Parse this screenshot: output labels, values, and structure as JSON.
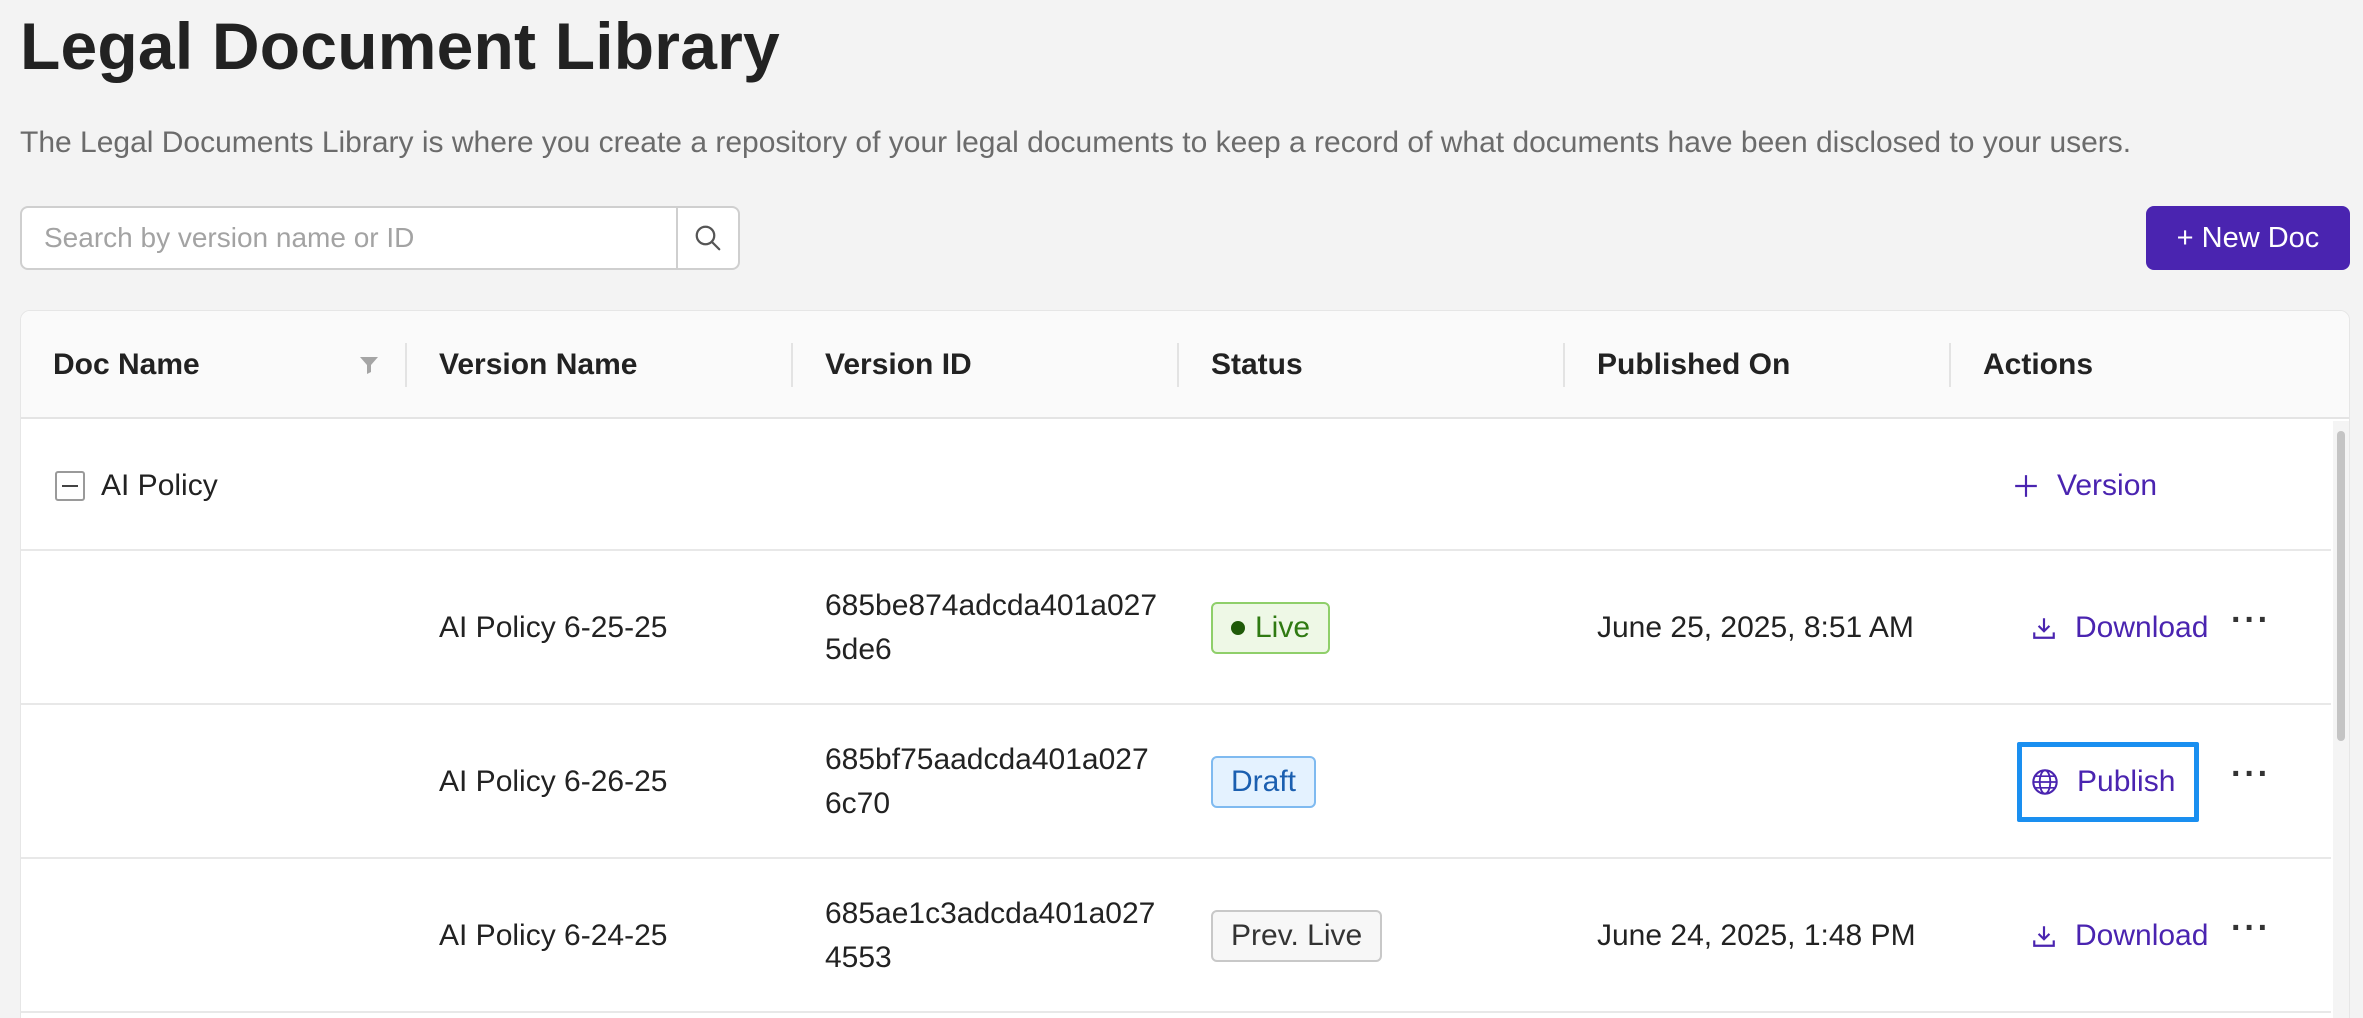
{
  "page": {
    "title": "Legal Document Library",
    "description": "The Legal Documents Library is where you create a repository of your legal documents to keep a record of what documents have been disclosed to your users."
  },
  "search": {
    "placeholder": "Search by version name or ID",
    "value": "",
    "icon": "search-icon"
  },
  "toolbar": {
    "new_doc_label": "+ New Doc"
  },
  "table": {
    "columns": [
      "Doc Name",
      "Version Name",
      "Version ID",
      "Status",
      "Published On",
      "Actions"
    ],
    "group": {
      "doc_name": "AI Policy",
      "add_version_label": "Version"
    },
    "rows": [
      {
        "version_name": "AI Policy 6-25-25",
        "version_id_line1": "685be874adcda401a027",
        "version_id_line2": "5de6",
        "status": "Live",
        "published_on": "June 25, 2025, 8:51 AM",
        "action_label": "Download",
        "more": "···"
      },
      {
        "version_name": "AI Policy 6-26-25",
        "version_id_line1": "685bf75aadcda401a027",
        "version_id_line2": "6c70",
        "status": "Draft",
        "published_on": "",
        "action_label": "Publish",
        "more": "···"
      },
      {
        "version_name": "AI Policy 6-24-25",
        "version_id_line1": "685ae1c3adcda401a027",
        "version_id_line2": "4553",
        "status": "Prev. Live",
        "published_on": "June 24, 2025, 1:48 PM",
        "action_label": "Download",
        "more": "···"
      }
    ]
  },
  "colors": {
    "primary": "#4a24b0",
    "focus_ring": "#1a8ff0",
    "live_bg": "#eef8e6",
    "live_text": "#2f7a12",
    "draft_bg": "#e4f2ff",
    "draft_text": "#1b5fb0"
  }
}
